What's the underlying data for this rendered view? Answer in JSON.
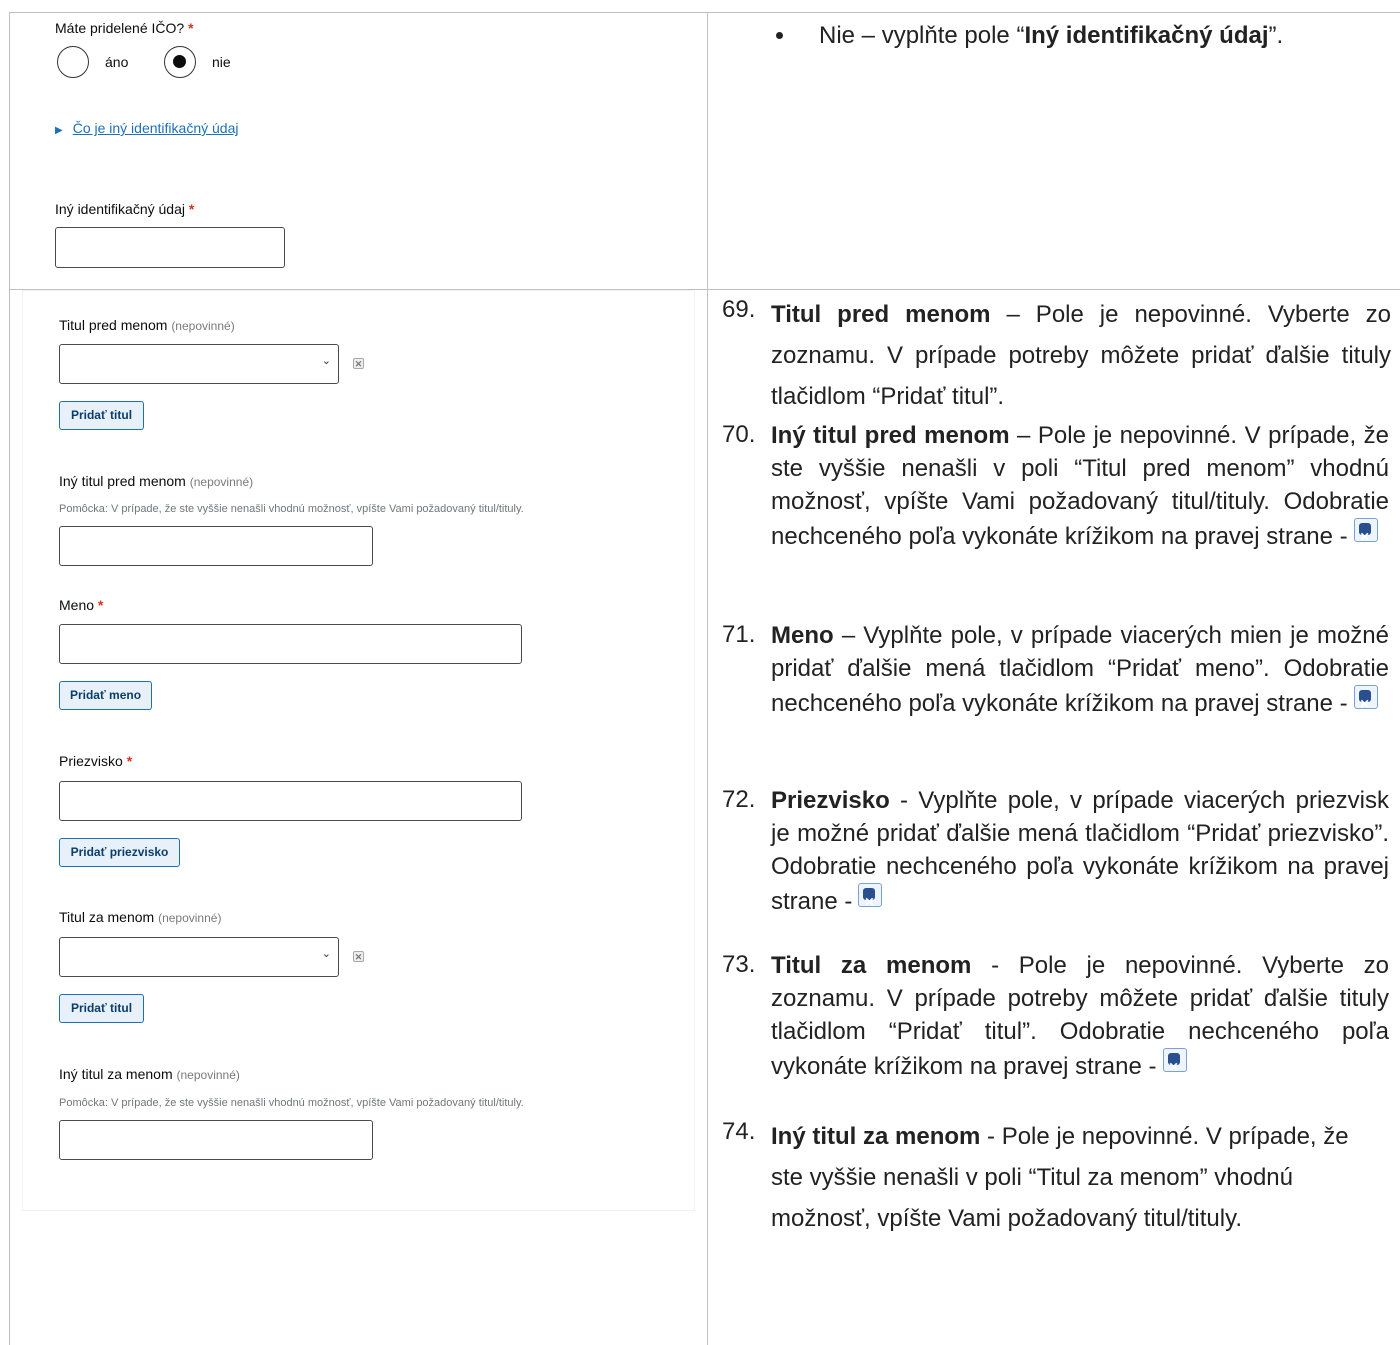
{
  "top_form": {
    "ico_question": "Máte pridelené IČO?",
    "required_mark": "*",
    "radio_yes": "áno",
    "radio_no": "nie",
    "details_link": "Čo je iný identifikačný údaj",
    "other_id_label": "Iný identifikačný údaj"
  },
  "top_instruction": {
    "prefix": "Nie – vyplňte pole “",
    "bold": "Iný identifikačný údaj",
    "suffix": "”."
  },
  "name_form": {
    "optional_tag": "(nepovinné)",
    "title_before_label": "Titul pred menom",
    "add_title_button": "Pridať titul",
    "other_title_before_label": "Iný titul pred menom",
    "hint": "Pomôcka: V prípade, že ste vyššie nenašli vhodnú možnosť, vpíšte Vami požadovaný titul/tituly.",
    "first_name_label": "Meno",
    "add_first_name_button": "Pridať meno",
    "surname_label": "Priezvisko",
    "add_surname_button": "Pridať priezvisko",
    "title_after_label": "Titul za menom",
    "other_title_after_label": "Iný titul za menom"
  },
  "instructions": [
    {
      "num": "69.",
      "bold": "Titul pred menom",
      "text": " – Pole je nepovinné. Vyberte zo zoznamu. V prípade potreby môžete pridať ďalšie tituly tlačidlom “Pridať titul”."
    },
    {
      "num": "70.",
      "bold": "Iný titul pred menom",
      "text": " – Pole je nepovinné. V prípade, že ste vyššie nenašli v poli “Titul pred menom” vhodnú možnosť, vpíšte Vami požadovaný titul/tituly. Odobratie nechceného poľa vykonáte krížikom na pravej strane -"
    },
    {
      "num": "71.",
      "bold": "Meno",
      "text": " – Vyplňte pole, v prípade viacerých mien je možné pridať ďalšie mená tlačidlom “Pridať meno”. Odobratie nechceného poľa vykonáte krížikom na pravej strane -"
    },
    {
      "num": "72.",
      "bold": "Priezvisko",
      "text": " - Vyplňte pole, v prípade viacerých priezvisk je možné pridať ďalšie mená tlačidlom “Pridať priezvisko”. Odobratie nechceného poľa vykonáte krížikom na pravej strane -"
    },
    {
      "num": "73.",
      "bold": "Titul za menom",
      "text": " - Pole je nepovinné. Vyberte zo zoznamu. V prípade potreby môžete pridať ďalšie tituly tlačidlom “Pridať titul”. Odobratie nechceného poľa vykonáte krížikom na pravej strane -"
    },
    {
      "num": "74.",
      "bold": "Iný titul za menom",
      "text": " - Pole je nepovinné. V prípade, že ste vyššie nenašli v poli “Titul za menom” vhodnú možnosť, vpíšte Vami požadovaný titul/tituly."
    }
  ]
}
